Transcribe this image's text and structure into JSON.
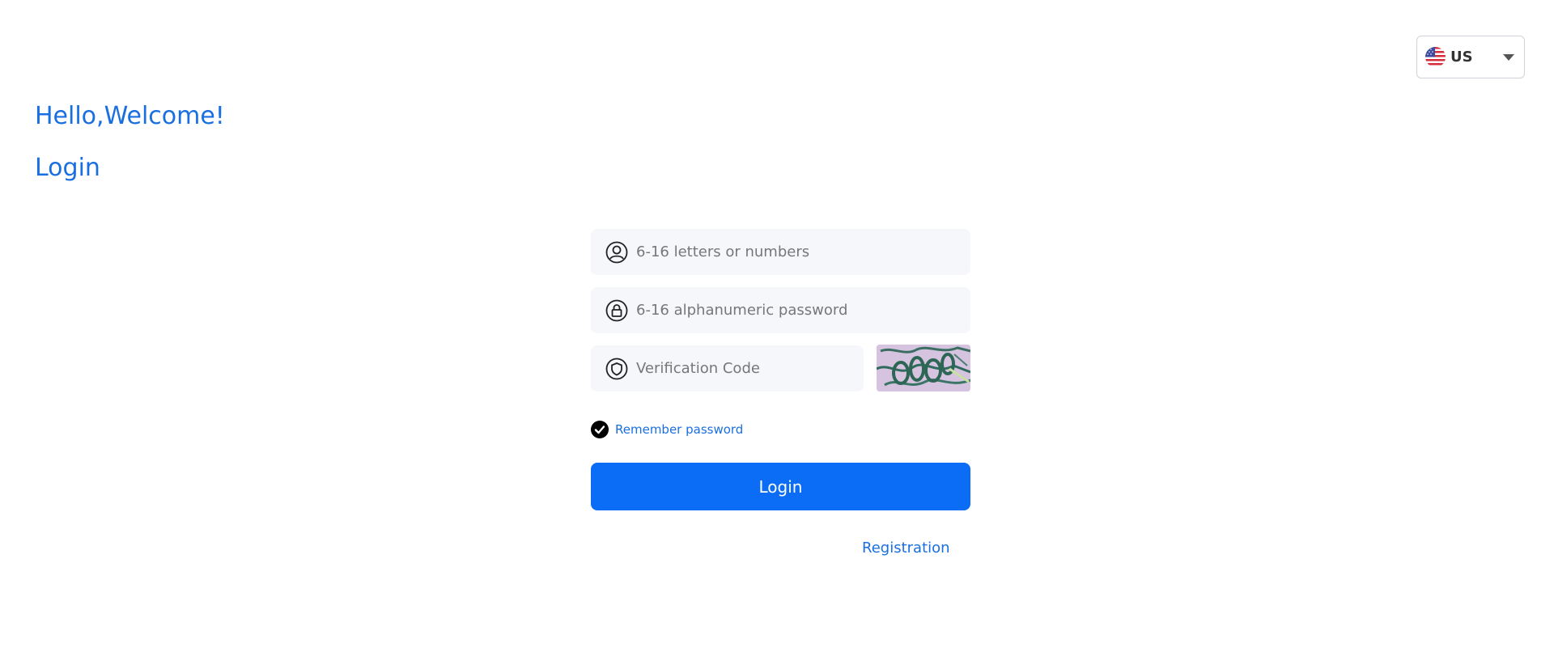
{
  "language_selector": {
    "label": "US",
    "flag_icon": "us-flag-icon",
    "dropdown_icon": "chevron-down-icon"
  },
  "greeting": {
    "welcome": "Hello,Welcome!",
    "title": "Login"
  },
  "form": {
    "username": {
      "icon": "user-icon",
      "placeholder": "6-16 letters or numbers",
      "value": ""
    },
    "password": {
      "icon": "lock-icon",
      "placeholder": "6-16 alphanumeric password",
      "value": ""
    },
    "verification": {
      "icon": "shield-icon",
      "placeholder": "Verification Code",
      "value": "",
      "captcha_image": "captcha-image"
    },
    "remember": {
      "label": "Remember password",
      "checked": true
    },
    "login_button": "Login",
    "registration_link": "Registration"
  },
  "colors": {
    "accent": "#1a6fe0",
    "button": "#0b6cf5",
    "field_background": "#f5f7fb"
  }
}
